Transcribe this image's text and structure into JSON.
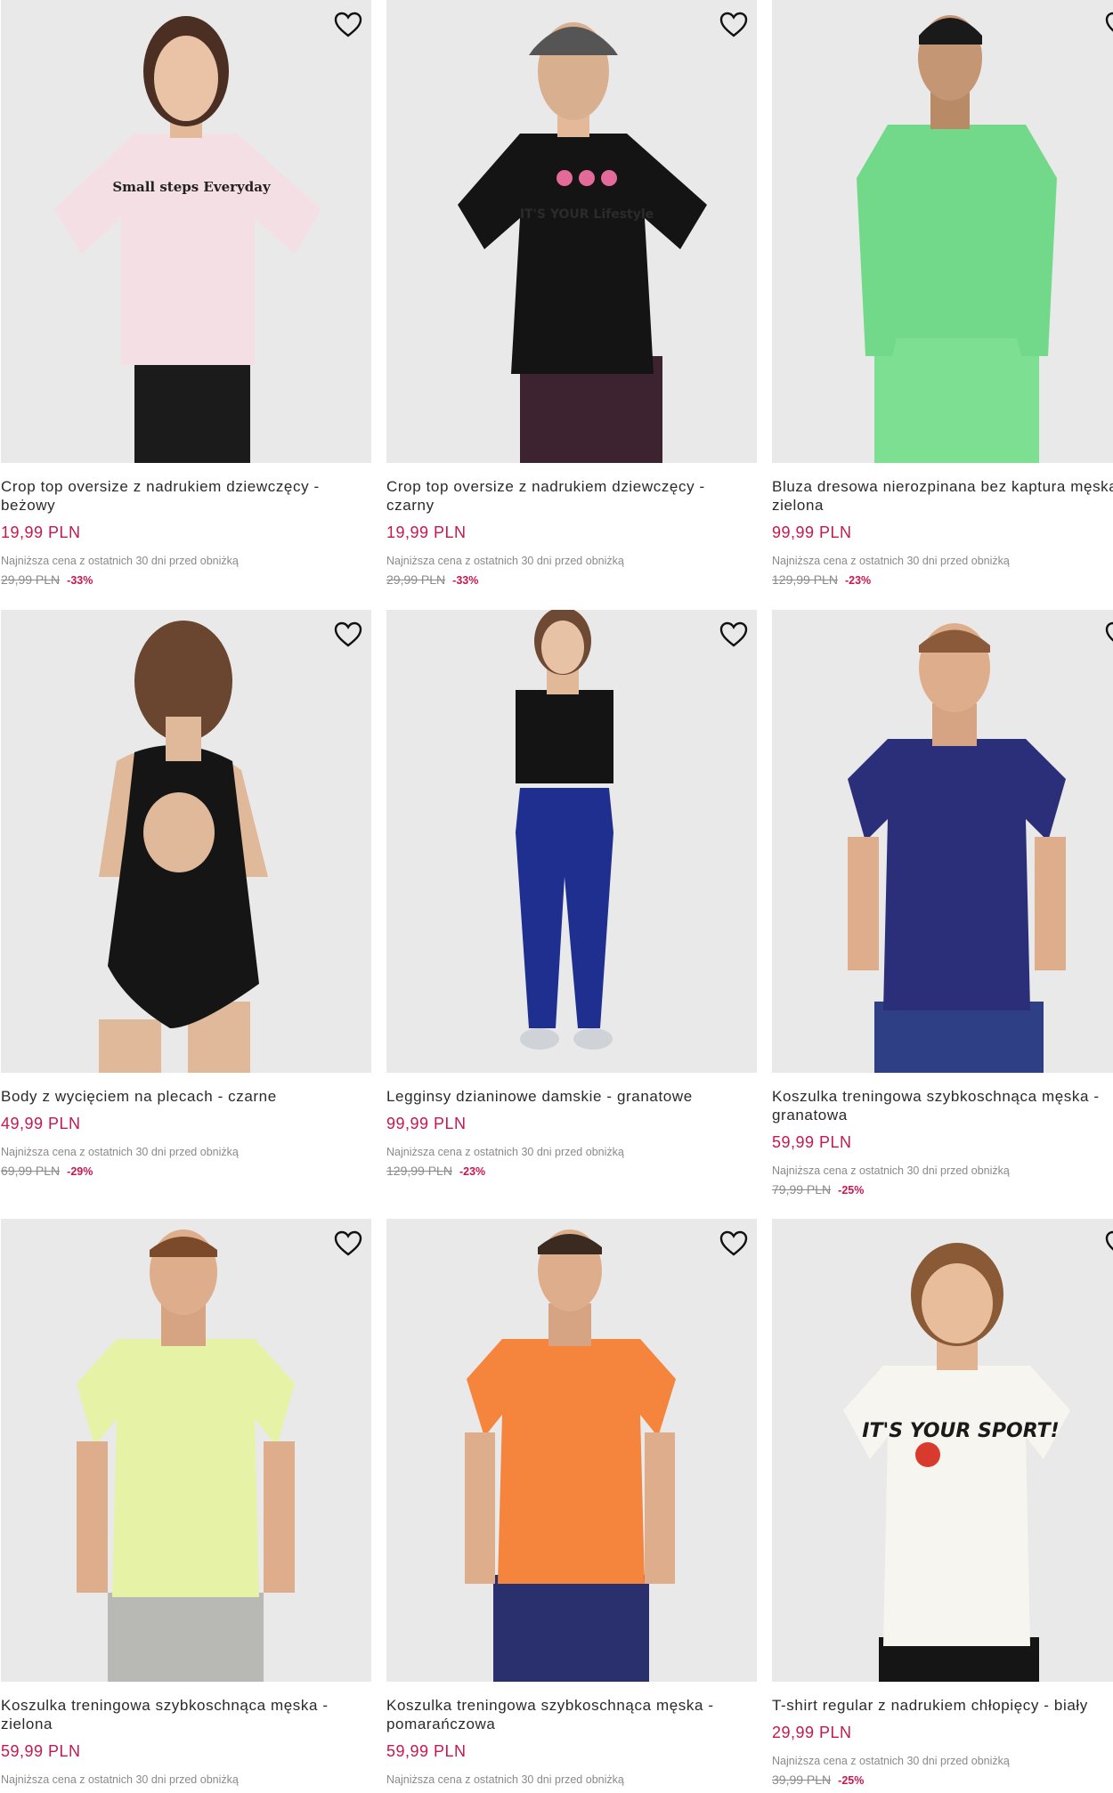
{
  "currency": "PLN",
  "lowest_price_label": "Najniższa cena z ostatnich 30 dni przed obniżką",
  "colors": {
    "accent": "#c8174f",
    "muted_text": "#8a8a8a",
    "image_bg": "#e9e9e9"
  },
  "products": [
    {
      "name": "Crop top oversize z nadrukiem dziewczęcy - beżowy",
      "price": "19,99 PLN",
      "old_price": "29,99 PLN",
      "discount": "-33%",
      "image_color": "#f4dfe4",
      "image_icon": "girl-pink-tshirt",
      "graphic_text": "Small steps Everyday"
    },
    {
      "name": "Crop top oversize z nadrukiem dziewczęcy - czarny",
      "price": "19,99 PLN",
      "old_price": "29,99 PLN",
      "discount": "-33%",
      "image_color": "#141414",
      "image_icon": "girl-black-tshirt",
      "graphic_text": "IT'S YOUR Lifestyle"
    },
    {
      "name": "Bluza dresowa nierozpinana bez kaptura męska - zielona",
      "price": "99,99 PLN",
      "old_price": "129,99 PLN",
      "discount": "-23%",
      "image_color": "#73d98a",
      "image_icon": "man-green-sweatshirt",
      "graphic_text": ""
    },
    {
      "name": "Body z wycięciem na plecach - czarne",
      "price": "49,99 PLN",
      "old_price": "69,99 PLN",
      "discount": "-29%",
      "image_color": "#151515",
      "image_icon": "woman-black-body",
      "graphic_text": ""
    },
    {
      "name": "Legginsy dzianinowe damskie - granatowe",
      "price": "99,99 PLN",
      "old_price": "129,99 PLN",
      "discount": "-23%",
      "image_color": "#1e2f8f",
      "image_icon": "woman-navy-leggings",
      "graphic_text": ""
    },
    {
      "name": "Koszulka treningowa szybkoschnąca męska - granatowa",
      "price": "59,99 PLN",
      "old_price": "79,99 PLN",
      "discount": "-25%",
      "image_color": "#2b2f7a",
      "image_icon": "man-navy-tshirt",
      "graphic_text": ""
    },
    {
      "name": "Koszulka treningowa szybkoschnąca męska - zielona",
      "price": "59,99 PLN",
      "old_price": "",
      "discount": "",
      "image_color": "#e6f2a6",
      "image_icon": "man-lime-tshirt",
      "graphic_text": ""
    },
    {
      "name": "Koszulka treningowa szybkoschnąca męska - pomarańczowa",
      "price": "59,99 PLN",
      "old_price": "",
      "discount": "",
      "image_color": "#f5843d",
      "image_icon": "man-orange-tshirt",
      "graphic_text": ""
    },
    {
      "name": "T-shirt regular z nadrukiem chłopięcy - biały",
      "price": "29,99 PLN",
      "old_price": "39,99 PLN",
      "discount": "-25%",
      "image_color": "#f7f5ef",
      "image_icon": "boy-white-tshirt",
      "graphic_text": "IT'S YOUR SPORT!"
    }
  ]
}
